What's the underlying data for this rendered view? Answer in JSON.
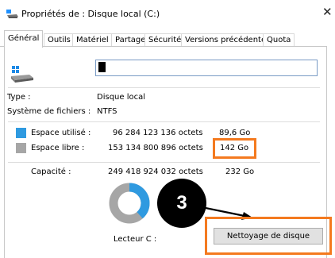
{
  "window": {
    "title": "Propriétés de : Disque local (C:)",
    "close_glyph": "✕"
  },
  "tabs": [
    {
      "label": "Général",
      "active": true
    },
    {
      "label": "Outils"
    },
    {
      "label": "Matériel"
    },
    {
      "label": "Partage"
    },
    {
      "label": "Sécurité"
    },
    {
      "label": "Versions précédentes"
    },
    {
      "label": "Quota"
    }
  ],
  "drive": {
    "icon": "drive-icon",
    "name_value": ""
  },
  "info": {
    "type_label": "Type :",
    "type_value": "Disque local",
    "fs_label": "Système de fichiers :",
    "fs_value": "NTFS"
  },
  "space": {
    "used_label": "Espace utilisé :",
    "used_bytes": "96 284 123 136 octets",
    "used_size": "89,6 Go",
    "used_color": "#2f9ae0",
    "free_label": "Espace libre :",
    "free_bytes": "153 134 800 896 octets",
    "free_size": "142 Go",
    "free_color": "#a6a6a6",
    "capacity_label": "Capacité :",
    "capacity_bytes": "249 418 924 032 octets",
    "capacity_size": "232 Go",
    "used_fraction": 0.386
  },
  "drive_label": "Lecteur C :",
  "cleanup_button": "Nettoyage de disque",
  "annotation": {
    "step_number": "3",
    "highlight_color": "#f47a1f"
  }
}
